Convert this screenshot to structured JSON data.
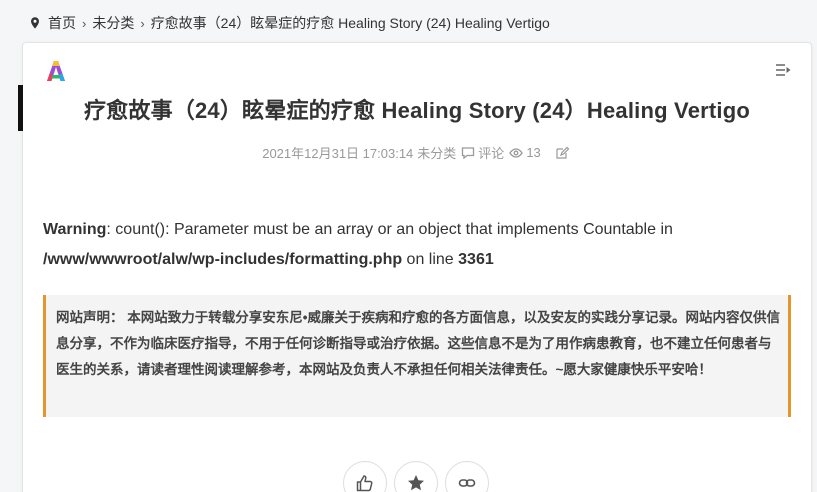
{
  "breadcrumb": {
    "home": "首页",
    "category": "未分类",
    "current": "疗愈故事（24）眩晕症的疗愈 Healing Story (24) Healing Vertigo"
  },
  "article": {
    "title": "疗愈故事（24）眩晕症的疗愈 Healing Story (24）Healing Vertigo",
    "meta": {
      "date": "2021年12月31日 17:03:14",
      "category": "未分类",
      "comment_label": "评论",
      "views": "13"
    },
    "warning": {
      "label": "Warning",
      "message": ": count(): Parameter must be an array or an object that implements Countable in",
      "path": "/www/wwwroot/alw/wp-includes/formatting.php",
      "on_line": " on line ",
      "line": "3361"
    },
    "notice": "网站声明： 本网站致力于转载分享安东尼•威廉关于疾病和疗愈的各方面信息，以及安友的实践分享记录。网站内容仅供信息分享，不作为临床医疗指导，不用于任何诊断指导或治疗依据。这些信息不是为了用作病患教育，也不建立任何患者与医生的关系，请读者理性阅读理解参考，本网站及负责人不承担任何相关法律责任。~愿大家健康快乐平安哈！"
  },
  "colors": {
    "notice_border": "#e5962b",
    "accent_bar": "#111111",
    "meta_text": "#999999"
  },
  "icons": [
    "location-pin-icon",
    "chevron-right-icon",
    "site-logo-icon",
    "toc-icon",
    "comment-icon",
    "eye-icon",
    "edit-icon",
    "thumbs-up-icon",
    "star-icon",
    "link-icon"
  ]
}
